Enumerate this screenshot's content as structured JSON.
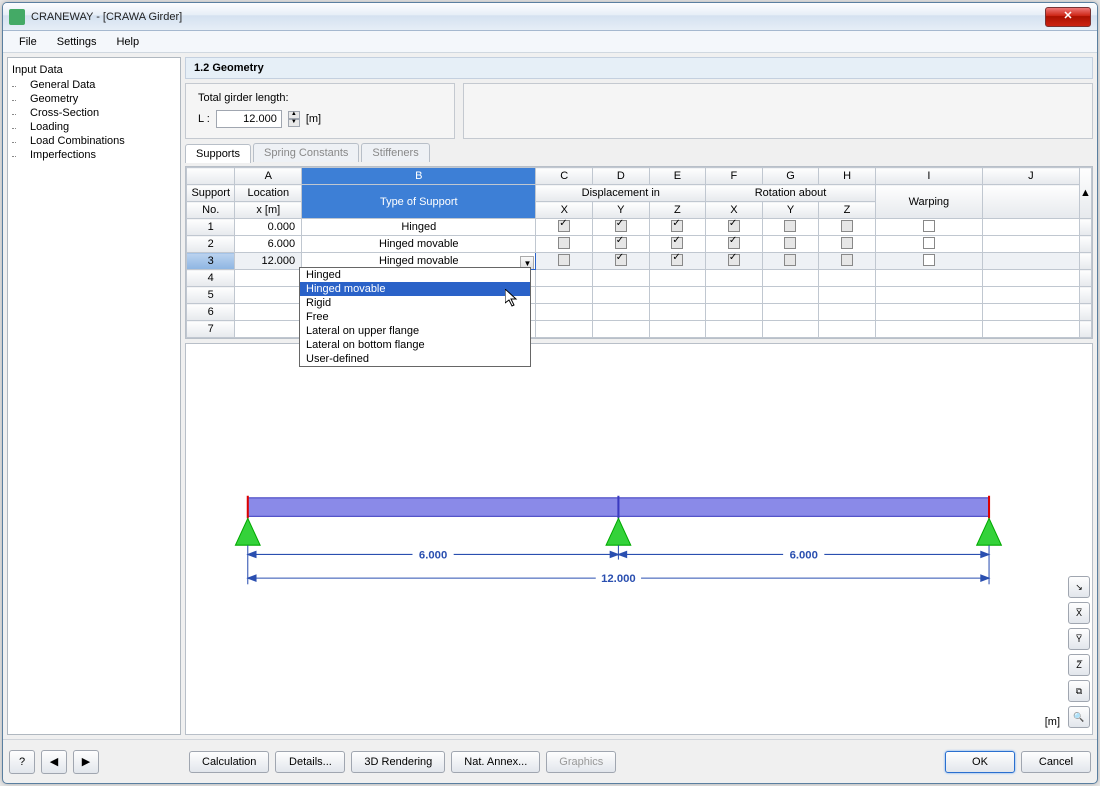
{
  "title": "CRANEWAY - [CRAWA Girder]",
  "menu": {
    "file": "File",
    "settings": "Settings",
    "help": "Help"
  },
  "sidebar": {
    "root": "Input Data",
    "items": [
      {
        "label": "General Data"
      },
      {
        "label": "Geometry"
      },
      {
        "label": "Cross-Section"
      },
      {
        "label": "Loading"
      },
      {
        "label": "Load Combinations"
      },
      {
        "label": "Imperfections"
      }
    ]
  },
  "section_title": "1.2 Geometry",
  "girder_length": {
    "label": "Total girder length:",
    "symbol": "L :",
    "value": "12.000",
    "unit": "[m]"
  },
  "tabs": [
    "Supports",
    "Spring Constants",
    "Stiffeners"
  ],
  "grid": {
    "colheads": [
      "A",
      "B",
      "C",
      "D",
      "E",
      "F",
      "G",
      "H",
      "I",
      "J"
    ],
    "group_disp": "Displacement in",
    "group_rot": "Rotation about",
    "rowhead1": "Support",
    "rowhead2": "No.",
    "loc_label": "Location",
    "loc_unit": "x [m]",
    "type_label": "Type of Support",
    "xyz": [
      "X",
      "Y",
      "Z",
      "X",
      "Y",
      "Z"
    ],
    "warping": "Warping",
    "rows": [
      {
        "no": "1",
        "x": "0.000",
        "type": "Hinged",
        "c": [
          "cg",
          "cg",
          "cg",
          "cg",
          "g",
          "g",
          "e"
        ]
      },
      {
        "no": "2",
        "x": "6.000",
        "type": "Hinged movable",
        "c": [
          "g",
          "cg",
          "cg",
          "cg",
          "g",
          "g",
          "e"
        ]
      },
      {
        "no": "3",
        "x": "12.000",
        "type": "Hinged movable",
        "c": [
          "g",
          "cg",
          "cg",
          "cg",
          "g",
          "g",
          "e"
        ]
      },
      {
        "no": "4",
        "x": "",
        "type": "",
        "c": [
          "",
          "",
          "",
          "",
          "",
          "",
          ""
        ]
      },
      {
        "no": "5",
        "x": "",
        "type": "",
        "c": [
          "",
          "",
          "",
          "",
          "",
          "",
          ""
        ]
      },
      {
        "no": "6",
        "x": "",
        "type": "",
        "c": [
          "",
          "",
          "",
          "",
          "",
          "",
          ""
        ]
      },
      {
        "no": "7",
        "x": "",
        "type": "",
        "c": [
          "",
          "",
          "",
          "",
          "",
          "",
          ""
        ]
      }
    ]
  },
  "dropdown": {
    "items": [
      "Hinged",
      "Hinged movable",
      "Rigid",
      "Free",
      "Lateral on upper flange",
      "Lateral on bottom flange",
      "User-defined"
    ],
    "highlight": 1
  },
  "diagram": {
    "d1": "6.000",
    "d2": "6.000",
    "total": "12.000",
    "unit": "[m]"
  },
  "toolbuttons": [
    "↘",
    "X̅",
    "Y̅",
    "Z̅",
    "⧉",
    "🔍"
  ],
  "footer": {
    "help": "?",
    "left": "◀",
    "right": "▶",
    "calc": "Calculation",
    "details": "Details...",
    "render": "3D Rendering",
    "annex": "Nat. Annex...",
    "graphics": "Graphics",
    "ok": "OK",
    "cancel": "Cancel"
  }
}
